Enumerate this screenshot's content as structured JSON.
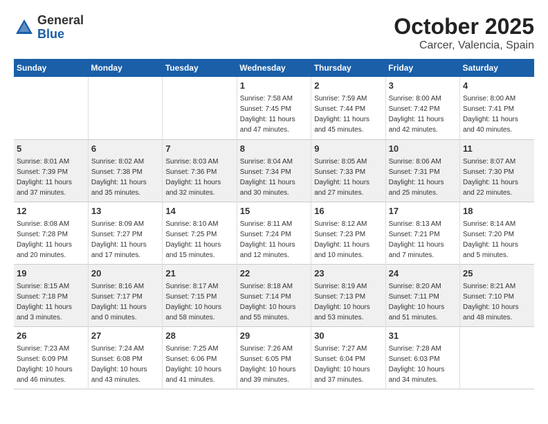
{
  "logo": {
    "general": "General",
    "blue": "Blue"
  },
  "title": "October 2025",
  "subtitle": "Carcer, Valencia, Spain",
  "days_of_week": [
    "Sunday",
    "Monday",
    "Tuesday",
    "Wednesday",
    "Thursday",
    "Friday",
    "Saturday"
  ],
  "weeks": [
    [
      {
        "day": "",
        "info": ""
      },
      {
        "day": "",
        "info": ""
      },
      {
        "day": "",
        "info": ""
      },
      {
        "day": "1",
        "info": "Sunrise: 7:58 AM\nSunset: 7:45 PM\nDaylight: 11 hours and 47 minutes."
      },
      {
        "day": "2",
        "info": "Sunrise: 7:59 AM\nSunset: 7:44 PM\nDaylight: 11 hours and 45 minutes."
      },
      {
        "day": "3",
        "info": "Sunrise: 8:00 AM\nSunset: 7:42 PM\nDaylight: 11 hours and 42 minutes."
      },
      {
        "day": "4",
        "info": "Sunrise: 8:00 AM\nSunset: 7:41 PM\nDaylight: 11 hours and 40 minutes."
      }
    ],
    [
      {
        "day": "5",
        "info": "Sunrise: 8:01 AM\nSunset: 7:39 PM\nDaylight: 11 hours and 37 minutes."
      },
      {
        "day": "6",
        "info": "Sunrise: 8:02 AM\nSunset: 7:38 PM\nDaylight: 11 hours and 35 minutes."
      },
      {
        "day": "7",
        "info": "Sunrise: 8:03 AM\nSunset: 7:36 PM\nDaylight: 11 hours and 32 minutes."
      },
      {
        "day": "8",
        "info": "Sunrise: 8:04 AM\nSunset: 7:34 PM\nDaylight: 11 hours and 30 minutes."
      },
      {
        "day": "9",
        "info": "Sunrise: 8:05 AM\nSunset: 7:33 PM\nDaylight: 11 hours and 27 minutes."
      },
      {
        "day": "10",
        "info": "Sunrise: 8:06 AM\nSunset: 7:31 PM\nDaylight: 11 hours and 25 minutes."
      },
      {
        "day": "11",
        "info": "Sunrise: 8:07 AM\nSunset: 7:30 PM\nDaylight: 11 hours and 22 minutes."
      }
    ],
    [
      {
        "day": "12",
        "info": "Sunrise: 8:08 AM\nSunset: 7:28 PM\nDaylight: 11 hours and 20 minutes."
      },
      {
        "day": "13",
        "info": "Sunrise: 8:09 AM\nSunset: 7:27 PM\nDaylight: 11 hours and 17 minutes."
      },
      {
        "day": "14",
        "info": "Sunrise: 8:10 AM\nSunset: 7:25 PM\nDaylight: 11 hours and 15 minutes."
      },
      {
        "day": "15",
        "info": "Sunrise: 8:11 AM\nSunset: 7:24 PM\nDaylight: 11 hours and 12 minutes."
      },
      {
        "day": "16",
        "info": "Sunrise: 8:12 AM\nSunset: 7:23 PM\nDaylight: 11 hours and 10 minutes."
      },
      {
        "day": "17",
        "info": "Sunrise: 8:13 AM\nSunset: 7:21 PM\nDaylight: 11 hours and 7 minutes."
      },
      {
        "day": "18",
        "info": "Sunrise: 8:14 AM\nSunset: 7:20 PM\nDaylight: 11 hours and 5 minutes."
      }
    ],
    [
      {
        "day": "19",
        "info": "Sunrise: 8:15 AM\nSunset: 7:18 PM\nDaylight: 11 hours and 3 minutes."
      },
      {
        "day": "20",
        "info": "Sunrise: 8:16 AM\nSunset: 7:17 PM\nDaylight: 11 hours and 0 minutes."
      },
      {
        "day": "21",
        "info": "Sunrise: 8:17 AM\nSunset: 7:15 PM\nDaylight: 10 hours and 58 minutes."
      },
      {
        "day": "22",
        "info": "Sunrise: 8:18 AM\nSunset: 7:14 PM\nDaylight: 10 hours and 55 minutes."
      },
      {
        "day": "23",
        "info": "Sunrise: 8:19 AM\nSunset: 7:13 PM\nDaylight: 10 hours and 53 minutes."
      },
      {
        "day": "24",
        "info": "Sunrise: 8:20 AM\nSunset: 7:11 PM\nDaylight: 10 hours and 51 minutes."
      },
      {
        "day": "25",
        "info": "Sunrise: 8:21 AM\nSunset: 7:10 PM\nDaylight: 10 hours and 48 minutes."
      }
    ],
    [
      {
        "day": "26",
        "info": "Sunrise: 7:23 AM\nSunset: 6:09 PM\nDaylight: 10 hours and 46 minutes."
      },
      {
        "day": "27",
        "info": "Sunrise: 7:24 AM\nSunset: 6:08 PM\nDaylight: 10 hours and 43 minutes."
      },
      {
        "day": "28",
        "info": "Sunrise: 7:25 AM\nSunset: 6:06 PM\nDaylight: 10 hours and 41 minutes."
      },
      {
        "day": "29",
        "info": "Sunrise: 7:26 AM\nSunset: 6:05 PM\nDaylight: 10 hours and 39 minutes."
      },
      {
        "day": "30",
        "info": "Sunrise: 7:27 AM\nSunset: 6:04 PM\nDaylight: 10 hours and 37 minutes."
      },
      {
        "day": "31",
        "info": "Sunrise: 7:28 AM\nSunset: 6:03 PM\nDaylight: 10 hours and 34 minutes."
      },
      {
        "day": "",
        "info": ""
      }
    ]
  ]
}
